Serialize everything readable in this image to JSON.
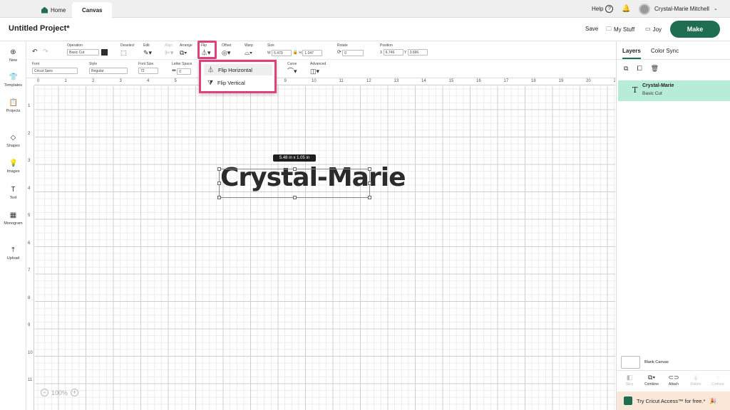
{
  "tabs": {
    "home": "Home",
    "canvas": "Canvas"
  },
  "top_right": {
    "help": "Help",
    "help_icon": "?",
    "user_name": "Crystal-Marie Mitchell"
  },
  "header": {
    "project_title": "Untitled Project*",
    "save": "Save",
    "my_stuff": "My Stuff",
    "joy": "Joy",
    "make": "Make"
  },
  "sidebar": {
    "items": [
      {
        "label": "New",
        "icon": "plus-circle-icon",
        "glyph": "⊕"
      },
      {
        "label": "Templates",
        "icon": "shirt-icon",
        "glyph": "👕"
      },
      {
        "label": "Projects",
        "icon": "clipboard-icon",
        "glyph": "📋"
      },
      {
        "label": "Shapes",
        "icon": "shapes-icon",
        "glyph": "◇"
      },
      {
        "label": "Images",
        "icon": "bulb-icon",
        "glyph": "💡"
      },
      {
        "label": "Text",
        "icon": "text-icon",
        "glyph": "T"
      },
      {
        "label": "Monogram",
        "icon": "monogram-icon",
        "glyph": "▦"
      },
      {
        "label": "Upload",
        "icon": "upload-icon",
        "glyph": "⤒"
      }
    ]
  },
  "toolbar1": {
    "operation_label": "Operation",
    "operation_value": "Basic Cut",
    "deselect_label": "Deselect",
    "edit_label": "Edit",
    "align_label": "Align",
    "arrange_label": "Arrange",
    "flip_label": "Flip",
    "offset_label": "Offset",
    "warp_label": "Warp",
    "size_label": "Size",
    "w_label": "W",
    "w_value": "5.479",
    "h_label": "H",
    "h_value": "1.047",
    "rotate_label": "Rotate",
    "rotate_value": "0",
    "position_label": "Position",
    "x_label": "X",
    "x_value": "6.746",
    "y_label": "Y",
    "y_value": "3.666"
  },
  "toolbar2": {
    "font_label": "Font",
    "font_value": "Cricut Sans",
    "style_label": "Style",
    "style_value": "Regular",
    "font_size_label": "Font Size",
    "font_size_value": "72",
    "letter_space_label": "Letter Space",
    "letter_space_value": "0",
    "curve_label": "Curve",
    "advanced_label": "Advanced"
  },
  "flip_menu": {
    "horizontal": "Flip Horizontal",
    "vertical": "Flip Vertical"
  },
  "canvas": {
    "size_tag": "5.48  in x 1.05  in",
    "design_text": "Crystal-Marie",
    "zoom": "100%",
    "ruler_top": [
      "0",
      "1",
      "2",
      "3",
      "4",
      "5",
      "6",
      "7",
      "8",
      "9",
      "10",
      "11",
      "12",
      "13",
      "14",
      "15",
      "16",
      "17",
      "18",
      "19",
      "20",
      "21"
    ],
    "ruler_left": [
      "1",
      "2",
      "3",
      "4",
      "5",
      "6",
      "7",
      "8",
      "9",
      "10",
      "11"
    ]
  },
  "right_panel": {
    "tab_layers": "Layers",
    "tab_color_sync": "Color Sync",
    "layer_name": "Crystal-Marie",
    "layer_operation": "Basic Cut",
    "blank_canvas": "Blank Canvas",
    "actions": [
      "Slice",
      "Combine",
      "Attach",
      "Flatten",
      "Contour"
    ],
    "access_promo": "Try Cricut Access™ for free.*"
  },
  "colors": {
    "brand_green": "#1f6e4f",
    "highlight_pink": "#e0407c",
    "layer_selected": "#b7ecd6",
    "promo_bg": "#fbe7d7"
  }
}
